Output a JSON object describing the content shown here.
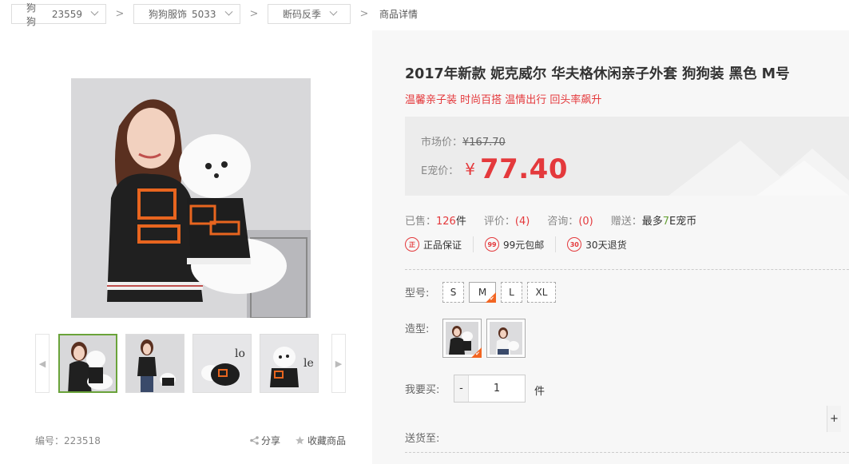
{
  "breadcrumb": {
    "items": [
      {
        "label": "狗狗",
        "count": "23559"
      },
      {
        "label": "狗狗服饰",
        "count": "5033"
      },
      {
        "label": "断码反季",
        "count": ""
      }
    ],
    "separator": ">",
    "current": "商品详情"
  },
  "gallery": {
    "prev_arrow": "◀",
    "next_arrow": "▶",
    "thumb_count": 4,
    "active_thumb": 0
  },
  "product": {
    "code_label": "编号：",
    "code": "223518",
    "share_label": "分享",
    "favorite_label": "收藏商品",
    "title": "2017年新款 妮克威尔 华夫格休闲亲子外套 狗狗装 黑色 M号",
    "subtitle": "温馨亲子装 时尚百搭 温情出行 回头率飙升"
  },
  "price": {
    "market_label": "市场价：",
    "market_value": "¥167.70",
    "e_label": "E宠价：",
    "currency": "¥",
    "e_value": "77.40",
    "accent_color": "#e4393c"
  },
  "stats": {
    "sold_label": "已售：",
    "sold_value": "126",
    "sold_unit": "件",
    "review_label": "评价：",
    "review_value": "(4)",
    "consult_label": "咨询：",
    "consult_value": "(0)",
    "gift_label": "赠送：",
    "gift_prefix": "最多",
    "gift_value": "7",
    "gift_suffix": "E宠币"
  },
  "services": [
    {
      "icon": "shield-icon",
      "glyph": "正",
      "label": "正品保证"
    },
    {
      "icon": "truck-icon",
      "glyph": "99",
      "label": "99元包邮"
    },
    {
      "icon": "return-30-icon",
      "glyph": "30",
      "label": "30天退货"
    }
  ],
  "options": {
    "size_label": "型号:",
    "sizes": [
      "S",
      "M",
      "L",
      "XL"
    ],
    "selected_size": "M",
    "style_label": "造型:",
    "qty_label": "我要买:",
    "qty_value": "1",
    "qty_minus": "-",
    "qty_plus": "+",
    "qty_unit": "件",
    "delivery_label": "送货至:"
  }
}
